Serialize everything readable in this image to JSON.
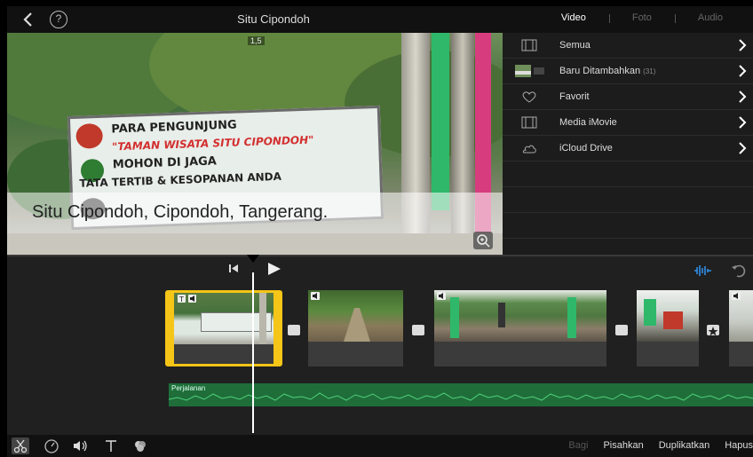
{
  "header": {
    "title": "Situ Cipondoh",
    "back_icon": "chevron-left-icon",
    "help_label": "?",
    "media_tabs": [
      {
        "label": "Video",
        "active": true
      },
      {
        "label": "Foto",
        "active": false
      },
      {
        "label": "Audio",
        "active": false
      }
    ]
  },
  "viewer": {
    "speed": "1,5",
    "caption": "Situ Cipondoh, Cipondoh, Tangerang.",
    "sign_lines": [
      "PARA PENGUNJUNG",
      "\"TAMAN WISATA SITU CIPONDOH\"",
      "MOHON DI JAGA",
      "TATA TERTIB & KESOPANAN ANDA"
    ]
  },
  "library": {
    "items": [
      {
        "label": "Semua",
        "icon": "film-icon"
      },
      {
        "label": "Baru Ditambahkan",
        "count": "(31)",
        "icon": "thumbnail-icon"
      },
      {
        "label": "Favorit",
        "icon": "heart-icon"
      },
      {
        "label": "Media iMovie",
        "icon": "film-icon"
      },
      {
        "label": "iCloud Drive",
        "icon": "cloud-icon"
      }
    ]
  },
  "timeline": {
    "audio_label": "Perjalanan"
  },
  "toolbar": {
    "actions": [
      {
        "label": "Bagi",
        "enabled": false
      },
      {
        "label": "Pisahkan",
        "enabled": true
      },
      {
        "label": "Duplikatkan",
        "enabled": true
      },
      {
        "label": "Hapus",
        "enabled": true
      }
    ]
  },
  "colors": {
    "selection": "#f5c518",
    "audio": "#1f6e3a",
    "accent": "#2f8fe8"
  }
}
